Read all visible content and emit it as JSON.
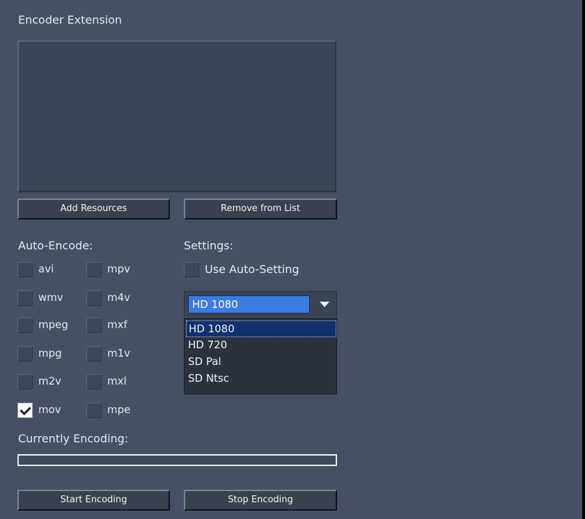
{
  "panel": {
    "title": "Encoder Extension"
  },
  "resources": {
    "add_label": "Add Resources",
    "remove_label": "Remove from List"
  },
  "auto_encode": {
    "heading": "Auto-Encode:",
    "formats": [
      {
        "label": "avi",
        "checked": false
      },
      {
        "label": "mpv",
        "checked": false
      },
      {
        "label": "wmv",
        "checked": false
      },
      {
        "label": "m4v",
        "checked": false
      },
      {
        "label": "mpeg",
        "checked": false
      },
      {
        "label": "mxf",
        "checked": false
      },
      {
        "label": "mpg",
        "checked": false
      },
      {
        "label": "m1v",
        "checked": false
      },
      {
        "label": "m2v",
        "checked": false
      },
      {
        "label": "mxl",
        "checked": false
      },
      {
        "label": "mov",
        "checked": true
      },
      {
        "label": "mpe",
        "checked": false
      }
    ]
  },
  "settings": {
    "heading": "Settings:",
    "use_auto_setting_label": "Use Auto-Setting",
    "use_auto_setting_checked": false,
    "preset_selected": "HD 1080",
    "preset_options": [
      "HD 1080",
      "HD 720",
      "SD Pal",
      "SD Ntsc"
    ]
  },
  "encoding": {
    "heading": "Currently Encoding:",
    "progress": 0,
    "start_label": "Start Encoding",
    "stop_label": "Stop Encoding"
  },
  "colors": {
    "background": "#455063",
    "selection": "#3c7be0",
    "dropdown_selected": "#11306e"
  }
}
